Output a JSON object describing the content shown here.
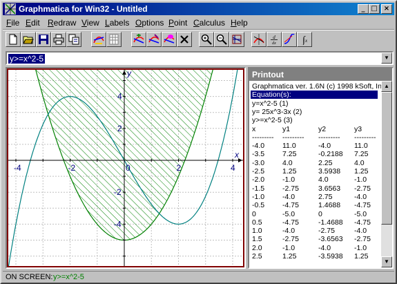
{
  "window": {
    "title": "Graphmatica for Win32 - Untitled"
  },
  "menu": [
    {
      "pre": "",
      "ul": "F",
      "post": "ile"
    },
    {
      "pre": "",
      "ul": "E",
      "post": "dit"
    },
    {
      "pre": "",
      "ul": "R",
      "post": "edraw"
    },
    {
      "pre": "",
      "ul": "V",
      "post": "iew"
    },
    {
      "pre": "",
      "ul": "L",
      "post": "abels"
    },
    {
      "pre": "",
      "ul": "O",
      "post": "ptions"
    },
    {
      "pre": "",
      "ul": "P",
      "post": "oint"
    },
    {
      "pre": "",
      "ul": "C",
      "post": "alculus"
    },
    {
      "pre": "",
      "ul": "H",
      "post": "elp"
    }
  ],
  "toolbar": {
    "icons": [
      "new-file-icon",
      "open-folder-icon",
      "save-icon",
      "print-icon",
      "copy-icon",
      "draw-graph-icon",
      "grid-icon",
      "add-curve-icon",
      "edit-curve-icon",
      "delete-curve-icon",
      "erase-icon",
      "zoom-in-icon",
      "zoom-out-icon",
      "zoom-fit-icon",
      "tangent-icon",
      "derivative-icon",
      "integrate-curve-icon",
      "integral-icon"
    ]
  },
  "equation": {
    "current": "y>=x^2-5"
  },
  "graph": {
    "x_ticks": [
      "-4",
      "-2",
      "0",
      "2",
      "4"
    ],
    "y_ticks": [
      "4",
      "2",
      "-2",
      "-4"
    ],
    "x_axis_label": "x",
    "y_axis_label": "y",
    "colors": {
      "border": "#800000",
      "grid": "#c0c0c0",
      "curve_fill": "#008000",
      "cubic": "#008080"
    }
  },
  "printout": {
    "title": "Printout",
    "lines": [
      "Graphmatica ver. 1.6N  (c) 1998 kSoft, Inc.",
      "Equation(s):",
      "y=x^2-5 (1)",
      "y= 25x^3-3x (2)",
      "y>=x^2-5 (3)"
    ],
    "headers": [
      "x",
      "y1",
      "y2",
      "y3"
    ],
    "dashes": "---------",
    "rows": [
      [
        "-4.0",
        "11.0",
        "-4.0",
        "11.0"
      ],
      [
        "-3.5",
        "7.25",
        "-0.2188",
        "7.25"
      ],
      [
        "-3.0",
        "4.0",
        "2.25",
        "4.0"
      ],
      [
        "-2.5",
        "1.25",
        "3.5938",
        "1.25"
      ],
      [
        "-2.0",
        "-1.0",
        "4.0",
        "-1.0"
      ],
      [
        "-1.5",
        "-2.75",
        "3.6563",
        "-2.75"
      ],
      [
        "-1.0",
        "-4.0",
        "2.75",
        "-4.0"
      ],
      [
        "-0.5",
        "-4.75",
        "1.4688",
        "-4.75"
      ],
      [
        "0",
        "-5.0",
        "0",
        "-5.0"
      ],
      [
        "0.5",
        "-4.75",
        "-1.4688",
        "-4.75"
      ],
      [
        "1.0",
        "-4.0",
        "-2.75",
        "-4.0"
      ],
      [
        "1.5",
        "-2.75",
        "-3.6563",
        "-2.75"
      ],
      [
        "2.0",
        "-1.0",
        "-4.0",
        "-1.0"
      ],
      [
        "2.5",
        "1.25",
        "-3.5938",
        "1.25"
      ]
    ]
  },
  "status": {
    "label": "ON SCREEN:",
    "value": "y>=x^2-5"
  }
}
